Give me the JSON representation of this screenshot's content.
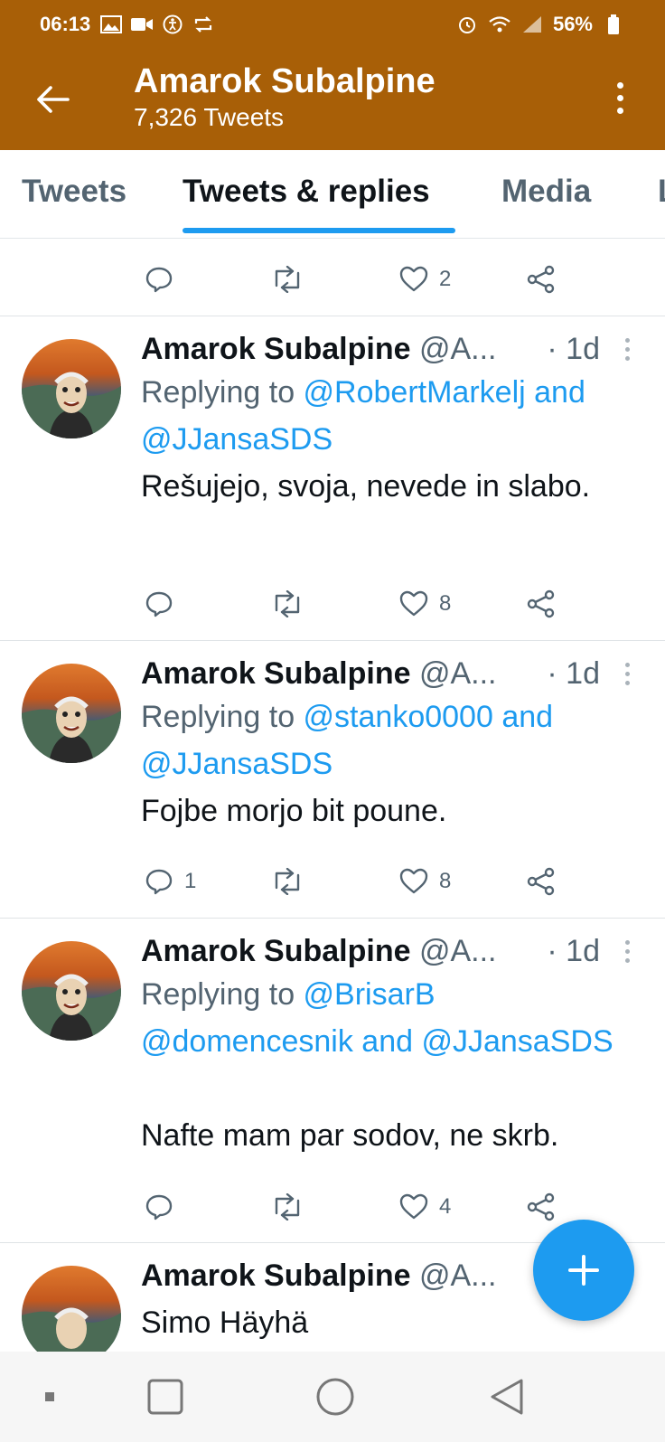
{
  "status_bar": {
    "time": "06:13",
    "battery": "56%",
    "left_icons": [
      "gallery-icon",
      "video-icon",
      "accessibility-icon",
      "sync-icon"
    ],
    "right_icons": [
      "alarm-icon",
      "wifi-icon",
      "signal-icon",
      "battery-icon"
    ]
  },
  "header": {
    "title": "Amarok Subalpine",
    "subtitle": "7,326 Tweets",
    "bg_color": "#a85f07"
  },
  "tabs": [
    {
      "label": "Tweets",
      "active": false
    },
    {
      "label": "Tweets & replies",
      "active": true
    },
    {
      "label": "Media",
      "active": false
    },
    {
      "label": "L",
      "active": false
    }
  ],
  "feed": {
    "top_actions": {
      "reply_count": "",
      "retweet_count": "",
      "like_count": "2"
    },
    "tweets": [
      {
        "name": "Amarok Subalpine",
        "handle": "@A...",
        "time": "· 1d",
        "replying_prefix": "Replying to ",
        "mentions": "@RobertMarkelj and @JJansaSDS",
        "text": "Rešujejo, svoja, nevede in slabo.",
        "reply_count": "",
        "retweet_count": "",
        "like_count": "8"
      },
      {
        "name": "Amarok Subalpine",
        "handle": "@A...",
        "time": "· 1d",
        "replying_prefix": "Replying to ",
        "mentions": "@stanko0000 and @JJansaSDS",
        "text": "Fojbe morjo bit poune.",
        "reply_count": "1",
        "retweet_count": "",
        "like_count": "8"
      },
      {
        "name": "Amarok Subalpine",
        "handle": "@A...",
        "time": "· 1d",
        "replying_prefix": "Replying to ",
        "mentions": "@BrisarB @domencesnik and @JJansaSDS",
        "text": "Nafte mam par sodov, ne skrb.",
        "reply_count": "",
        "retweet_count": "",
        "like_count": "4"
      },
      {
        "name": "Amarok Subalpine",
        "handle": "@A...",
        "time": "",
        "text": "Simo Häyhä"
      }
    ]
  },
  "colors": {
    "accent": "#1d9bf0",
    "muted": "#536471"
  }
}
